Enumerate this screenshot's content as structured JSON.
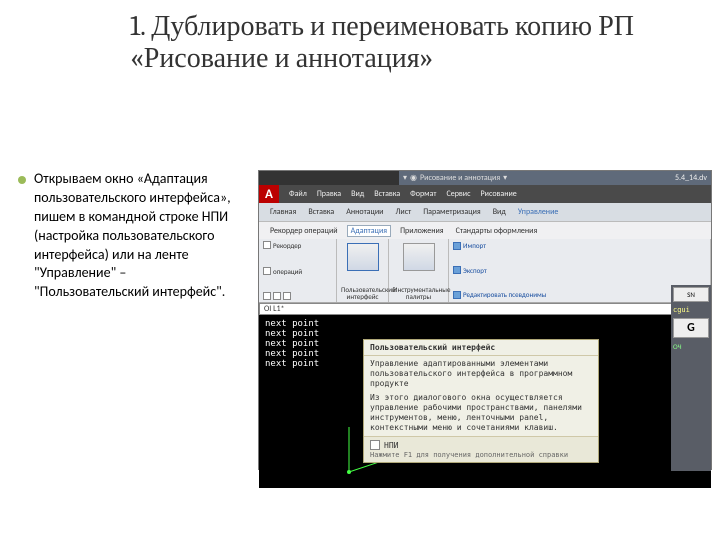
{
  "title": "1. Дублировать и переименовать копию РП «Рисование и аннотация»",
  "bullet": "Открываем окно «Адаптация пользовательского интерфейса», пишем в командной строке НПИ (настройка пользовательского интерфейса) или на ленте \"Управление\" – \"Пользовательский интерфейс\".",
  "screenshot": {
    "titlebar": {
      "workspace": "Рисование и аннотация",
      "date": "5.4_14.dv"
    },
    "menus": [
      "Файл",
      "Правка",
      "Вид",
      "Вставка",
      "Формат",
      "Сервис",
      "Рисование"
    ],
    "tabs": [
      "Главная",
      "Вставка",
      "Аннотации",
      "Лист",
      "Параметризация",
      "Вид",
      "Управление"
    ],
    "active_tab": "Управление",
    "ribbon": {
      "sub_tabs": [
        "Рекордер операций",
        "Адаптация",
        "Приложения",
        "Стандарты оформления"
      ],
      "group_record": {
        "row1": "Рекордер",
        "row2": "операций"
      },
      "group_cui": {
        "label": "Пользовательский\nинтерфейс"
      },
      "group_palettes": {
        "label": "Инструментальные\nпалитры"
      },
      "group_right": {
        "import": "Импорт",
        "export": "Экспорт",
        "alias": "Редактировать псевдонимы"
      }
    },
    "cmdline": "OI L1*",
    "drawing_text": [
      "next  point",
      "next  point",
      "next  point",
      "next  point",
      "next  point"
    ],
    "tooltip": {
      "heading": "Пользовательский интерфейс",
      "line1": "Управление адаптированными элементами пользовательского интерфейса в программном продукте",
      "line2": "Из этого диалогового окна осуществляется управление рабочими пространствами, панелями инструментов, меню, ленточными panel, контекстными меню и сочетаниями клавиш.",
      "foot_cmd": "НПИ",
      "foot_help": "Нажмите F1 для получения дополнительной справки"
    },
    "right_strip": {
      "sn": "SN",
      "cgui": "cgui",
      "g": "G",
      "oc": "ОЧ"
    }
  }
}
